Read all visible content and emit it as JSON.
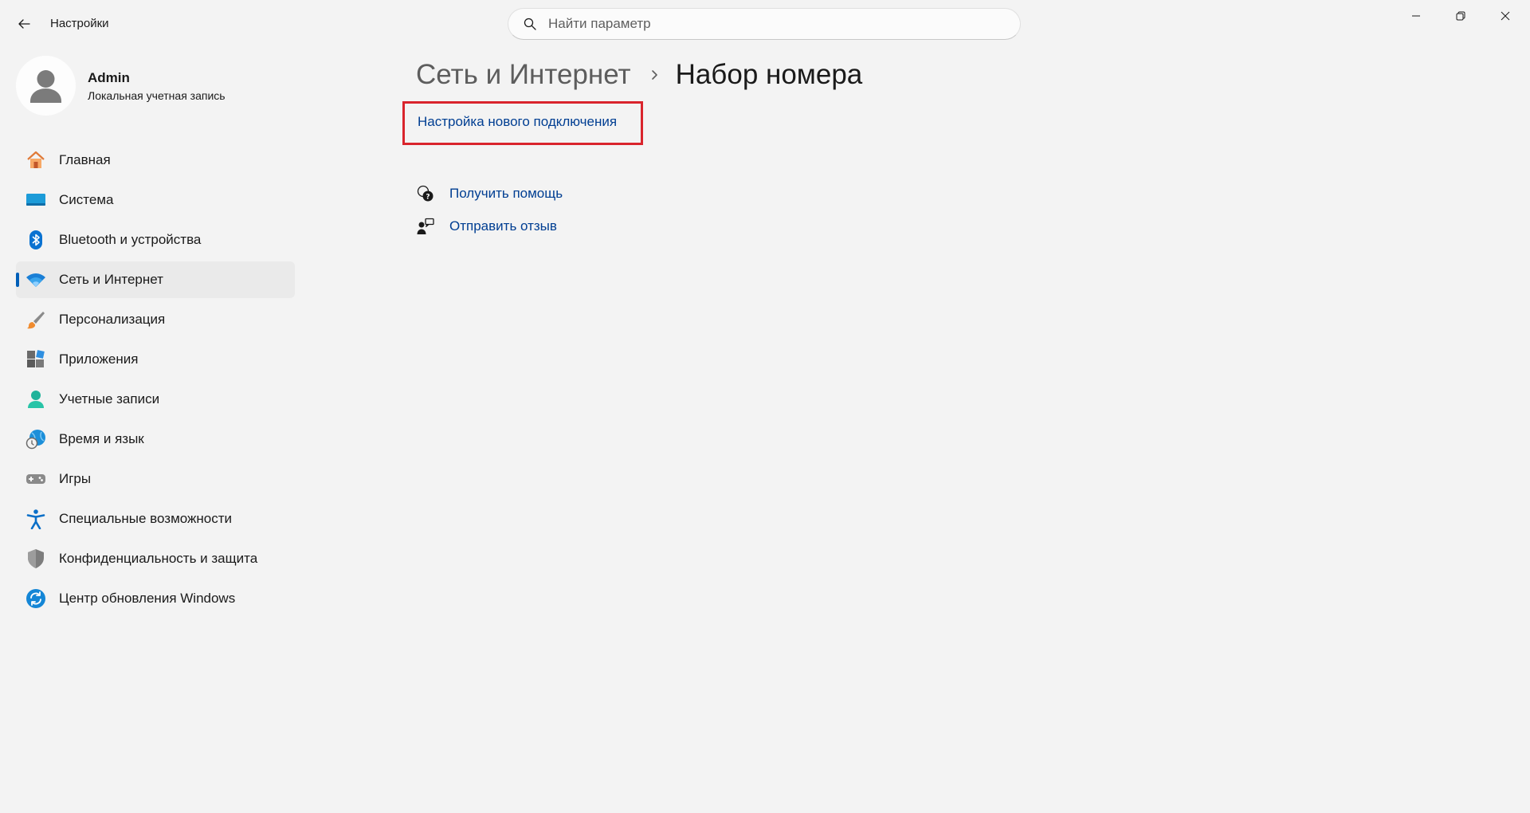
{
  "window": {
    "title": "Настройки",
    "controls": {
      "minimize": "minimize",
      "restore": "restore",
      "close": "close"
    }
  },
  "search": {
    "placeholder": "Найти параметр",
    "value": ""
  },
  "profile": {
    "name": "Admin",
    "account_type": "Локальная учетная запись"
  },
  "sidebar": {
    "items": [
      {
        "label": "Главная",
        "icon": "home-icon",
        "active": false
      },
      {
        "label": "Система",
        "icon": "system-icon",
        "active": false
      },
      {
        "label": "Bluetooth и устройства",
        "icon": "bluetooth-icon",
        "active": false
      },
      {
        "label": "Сеть и Интернет",
        "icon": "wifi-icon",
        "active": true
      },
      {
        "label": "Персонализация",
        "icon": "brush-icon",
        "active": false
      },
      {
        "label": "Приложения",
        "icon": "apps-icon",
        "active": false
      },
      {
        "label": "Учетные записи",
        "icon": "accounts-icon",
        "active": false
      },
      {
        "label": "Время и язык",
        "icon": "time-language-icon",
        "active": false
      },
      {
        "label": "Игры",
        "icon": "gamepad-icon",
        "active": false
      },
      {
        "label": "Специальные возможности",
        "icon": "accessibility-icon",
        "active": false
      },
      {
        "label": "Конфиденциальность и защита",
        "icon": "shield-icon",
        "active": false
      },
      {
        "label": "Центр обновления Windows",
        "icon": "update-icon",
        "active": false
      }
    ]
  },
  "main": {
    "breadcrumb": {
      "parent": "Сеть и Интернет",
      "current": "Набор номера"
    },
    "new_connection_link": "Настройка нового подключения",
    "help": {
      "get_help": "Получить помощь",
      "send_feedback": "Отправить отзыв"
    }
  },
  "colors": {
    "accent": "#005fb8",
    "link": "#003e92",
    "highlight": "#d9242c",
    "background": "#f3f3f3"
  }
}
